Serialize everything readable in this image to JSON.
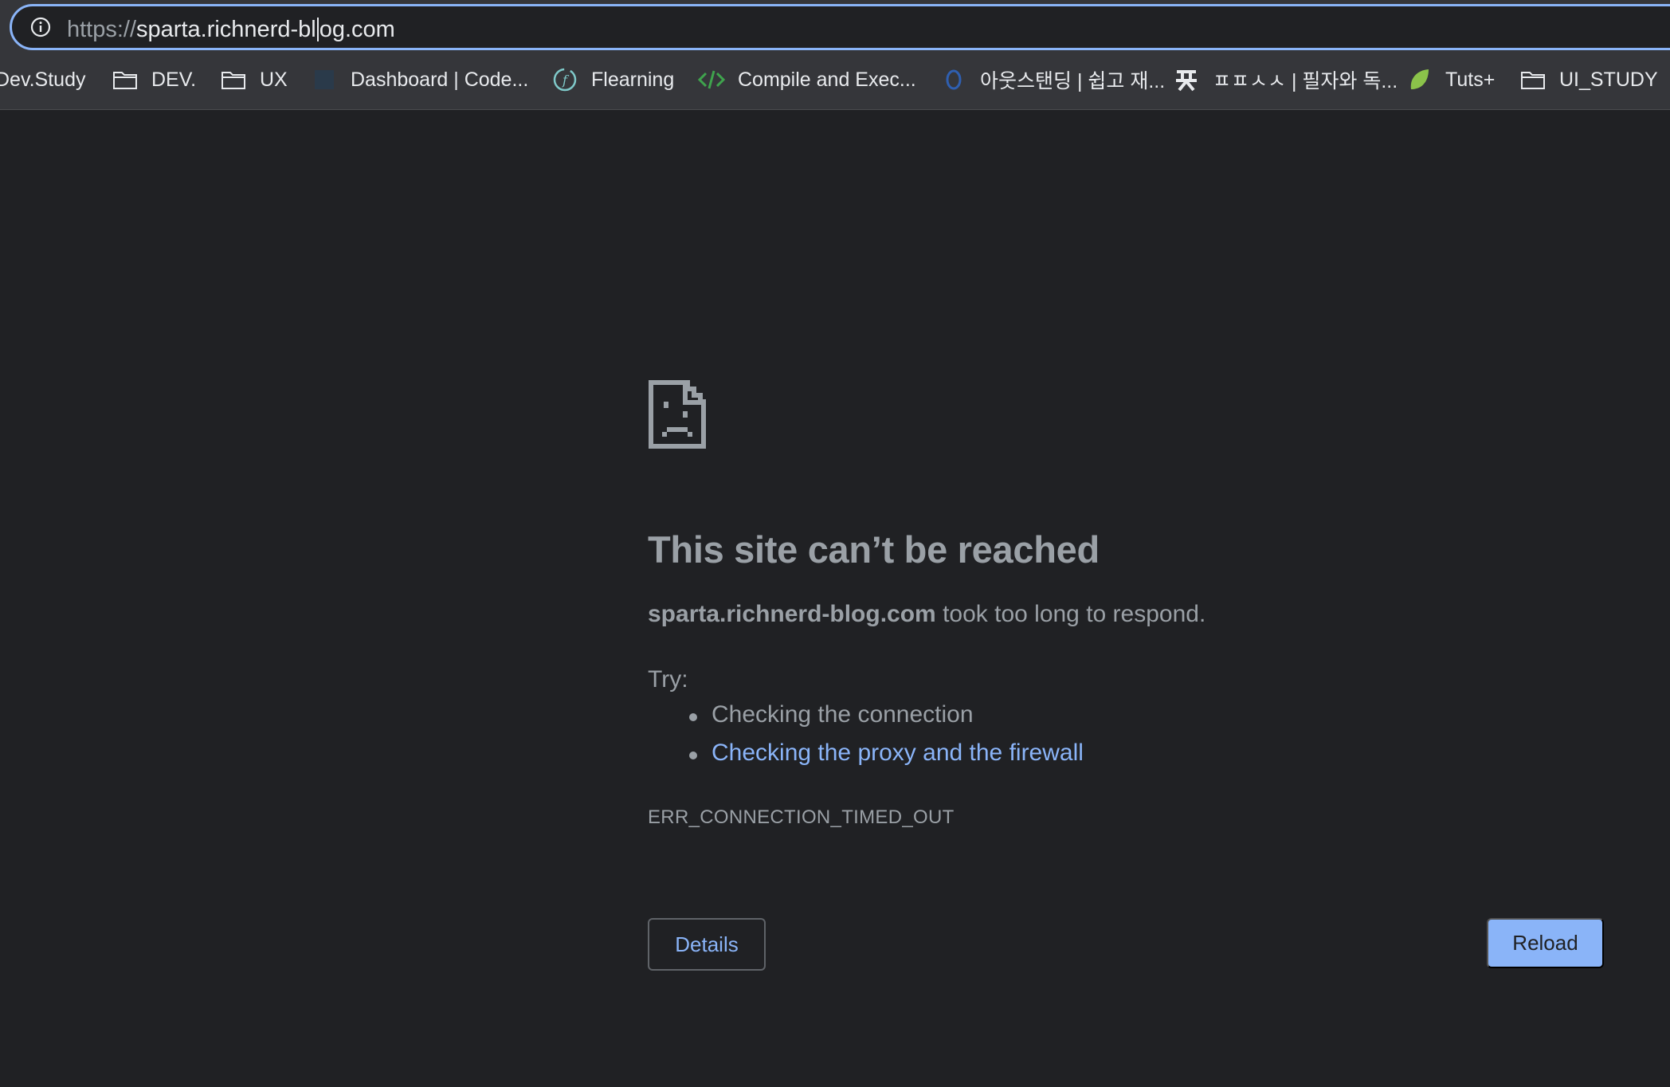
{
  "browser": {
    "url_scheme": "https://",
    "url_host_before_caret": "sparta.richnerd-bl",
    "url_host_after_caret": "og.com"
  },
  "bookmarks": [
    {
      "label": "Dev.Study",
      "icon": "none"
    },
    {
      "label": "DEV.",
      "icon": "folder-icon"
    },
    {
      "label": "UX",
      "icon": "folder-icon"
    },
    {
      "label": "Dashboard | Code...",
      "icon": "codecademy-icon"
    },
    {
      "label": "Flearning",
      "icon": "flearning-icon"
    },
    {
      "label": "Compile and Exec...",
      "icon": "code-brackets-icon"
    },
    {
      "label": "아웃스탠딩 | 쉽고 재...",
      "icon": "outstanding-icon"
    },
    {
      "label": "ㅍㅍㅅㅅ | 필자와 독...",
      "icon": "ppss-icon"
    },
    {
      "label": "Tuts+",
      "icon": "tuts-leaf-icon"
    },
    {
      "label": "UI_STUDY",
      "icon": "folder-icon"
    }
  ],
  "error_page": {
    "title": "This site can’t be reached",
    "host": "sparta.richnerd-blog.com",
    "message_suffix": " took too long to respond.",
    "try_label": "Try:",
    "suggestions": [
      {
        "text": "Checking the connection",
        "is_link": false
      },
      {
        "text": "Checking the proxy and the firewall",
        "is_link": true
      }
    ],
    "error_code": "ERR_CONNECTION_TIMED_OUT",
    "details_label": "Details",
    "reload_label": "Reload"
  },
  "colors": {
    "background": "#202124",
    "text_secondary": "#9aa0a6",
    "link": "#8ab4f8",
    "button_primary": "#8ab4f8"
  }
}
